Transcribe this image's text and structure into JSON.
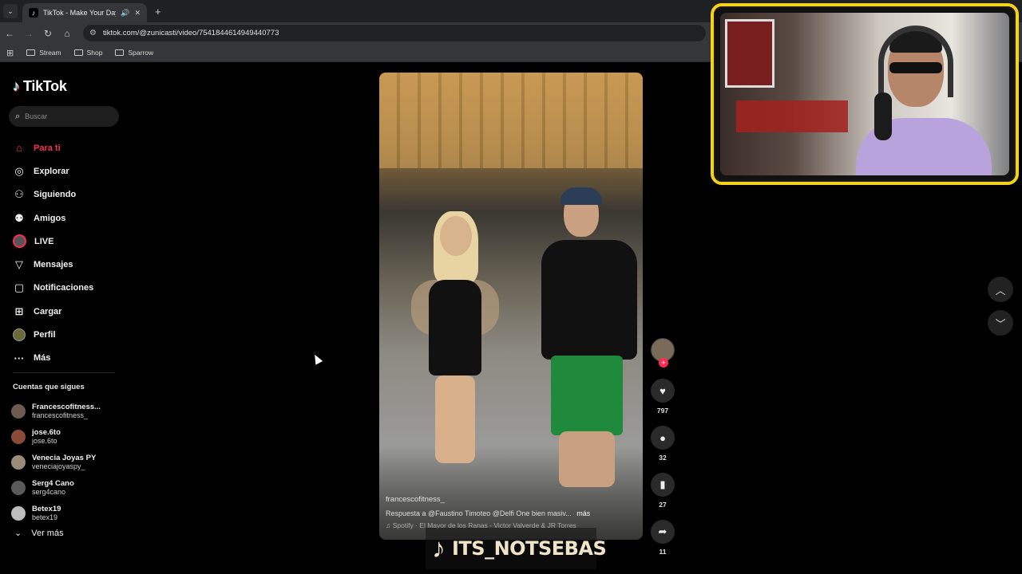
{
  "browser": {
    "tab_title": "TikTok - Make Your Day",
    "url": "tiktok.com/@zunicasti/video/7541844614949440773",
    "bookmarks": [
      "Stream",
      "Shop",
      "Sparrow"
    ]
  },
  "tiktok": {
    "logo": "TikTok",
    "search_placeholder": "Buscar",
    "menu": [
      {
        "label": "Para ti",
        "icon": "home-icon",
        "active": true
      },
      {
        "label": "Explorar",
        "icon": "compass-icon"
      },
      {
        "label": "Siguiendo",
        "icon": "following-icon"
      },
      {
        "label": "Amigos",
        "icon": "friends-icon"
      },
      {
        "label": "LIVE",
        "icon": "live-icon"
      },
      {
        "label": "Mensajes",
        "icon": "messages-icon"
      },
      {
        "label": "Notificaciones",
        "icon": "notifications-icon"
      },
      {
        "label": "Cargar",
        "icon": "upload-icon"
      },
      {
        "label": "Perfil",
        "icon": "profile-icon"
      },
      {
        "label": "Más",
        "icon": "more-icon"
      }
    ],
    "following_title": "Cuentas que sigues",
    "accounts": [
      {
        "name": "Francescofitness...",
        "handle": "francescofitness_"
      },
      {
        "name": "jose.6to",
        "handle": "jose.6to"
      },
      {
        "name": "Venecia Joyas PY",
        "handle": "veneciajoyaspy_"
      },
      {
        "name": "Serg4 Cano",
        "handle": "serg4cano"
      },
      {
        "name": "Betex19",
        "handle": "betex19"
      }
    ],
    "ver_mas": "Ver más"
  },
  "video": {
    "username": "francescofitness_",
    "caption": "Respuesta a @Faustino Timoteo @Delfi One",
    "caption_tail": "bien masiv...",
    "more_label": "más",
    "music": "♫ Spotify · El Mayor de los Ranas - Victor Valverde & JR Torres",
    "likes": "797",
    "comments": "32",
    "saves": "27",
    "shares": "11"
  },
  "overlay": {
    "watermark": "ITS_NOTSEBAS"
  },
  "colors": {
    "accent": "#fe2c55",
    "cam_border": "#f4d21b"
  }
}
